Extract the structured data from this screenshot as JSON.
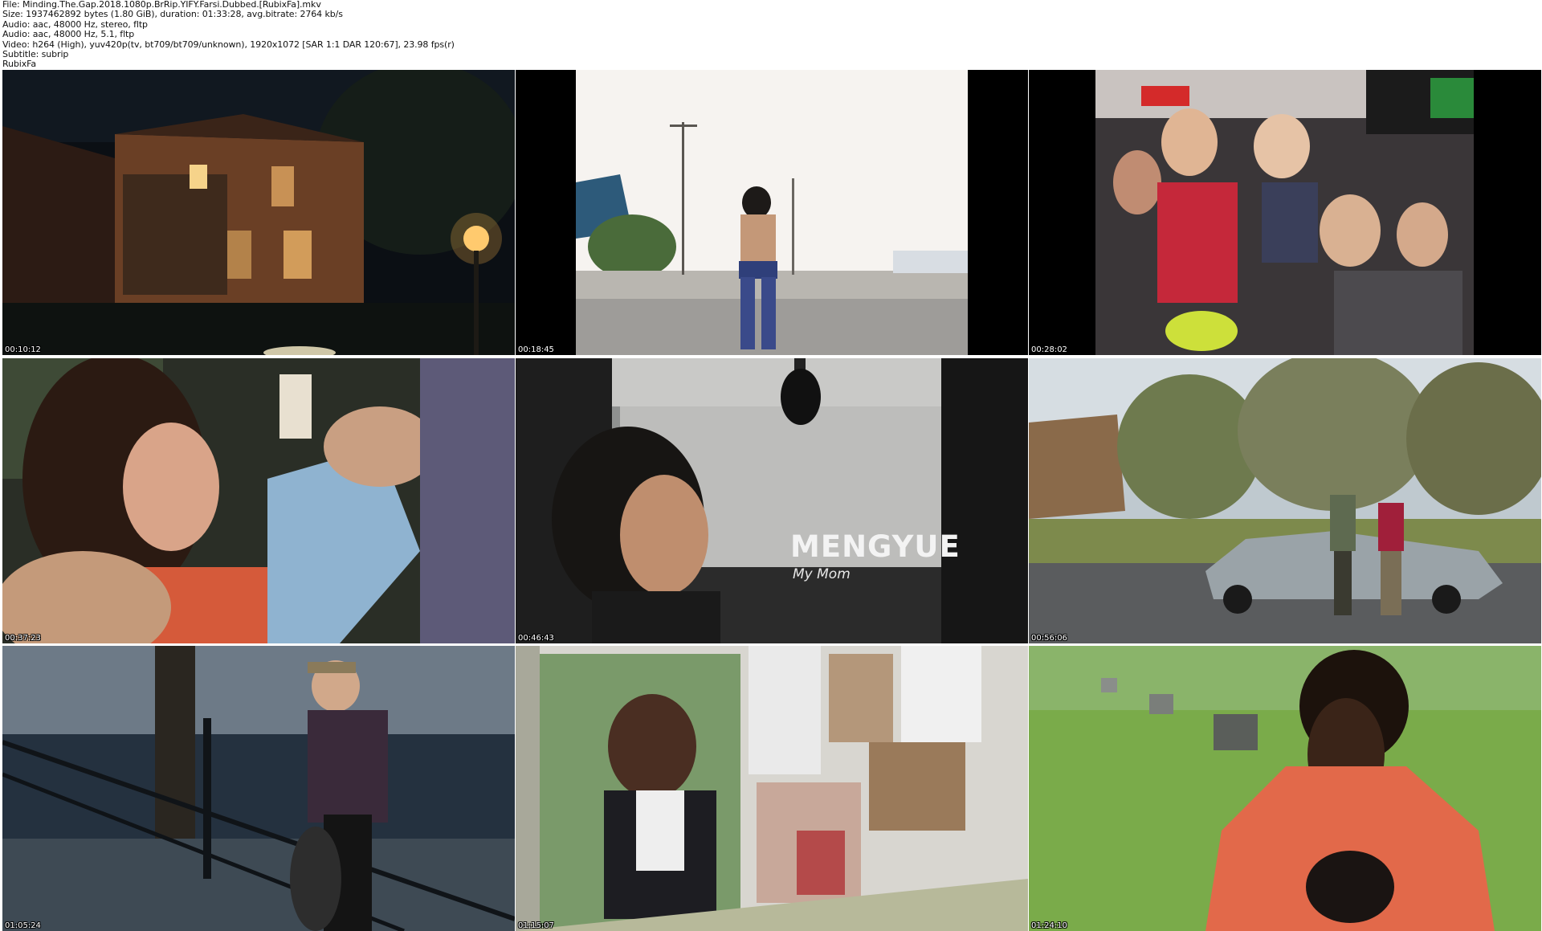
{
  "info": {
    "file": "File: Minding.The.Gap.2018.1080p.BrRip.YIFY.Farsi.Dubbed.[RubixFa].mkv",
    "size": "Size: 1937462892 bytes (1.80 GiB), duration: 01:33:28, avg.bitrate: 2764 kb/s",
    "audio1": "Audio: aac, 48000 Hz, stereo, fltp",
    "audio2": "Audio: aac, 48000 Hz, 5.1, fltp",
    "video": "Video: h264 (High), yuv420p(tv, bt709/bt709/unknown), 1920x1072 [SAR 1:1 DAR 120:67], 23.98 fps(r)",
    "subtitle": "Subtitle: subrip",
    "tag": "RubixFa"
  },
  "frames": [
    {
      "timestamp": "00:10:12",
      "scene": "night-house"
    },
    {
      "timestamp": "00:18:45",
      "scene": "rooftop-skater"
    },
    {
      "timestamp": "00:28:02",
      "scene": "kids-bmx"
    },
    {
      "timestamp": "00:37:23",
      "scene": "mother-baby"
    },
    {
      "timestamp": "00:46:43",
      "scene": "mengyue-interview",
      "title": "MENGYUE",
      "subtitle": "My Mom"
    },
    {
      "timestamp": "00:56:06",
      "scene": "street-car"
    },
    {
      "timestamp": "01:05:24",
      "scene": "stairs-skater"
    },
    {
      "timestamp": "01:15:07",
      "scene": "photo-wall"
    },
    {
      "timestamp": "01:24:10",
      "scene": "cemetery-smile"
    }
  ],
  "colors": {
    "background": "#ffffff",
    "timestamp_text": "#ffffff",
    "info_text": "#111111"
  }
}
